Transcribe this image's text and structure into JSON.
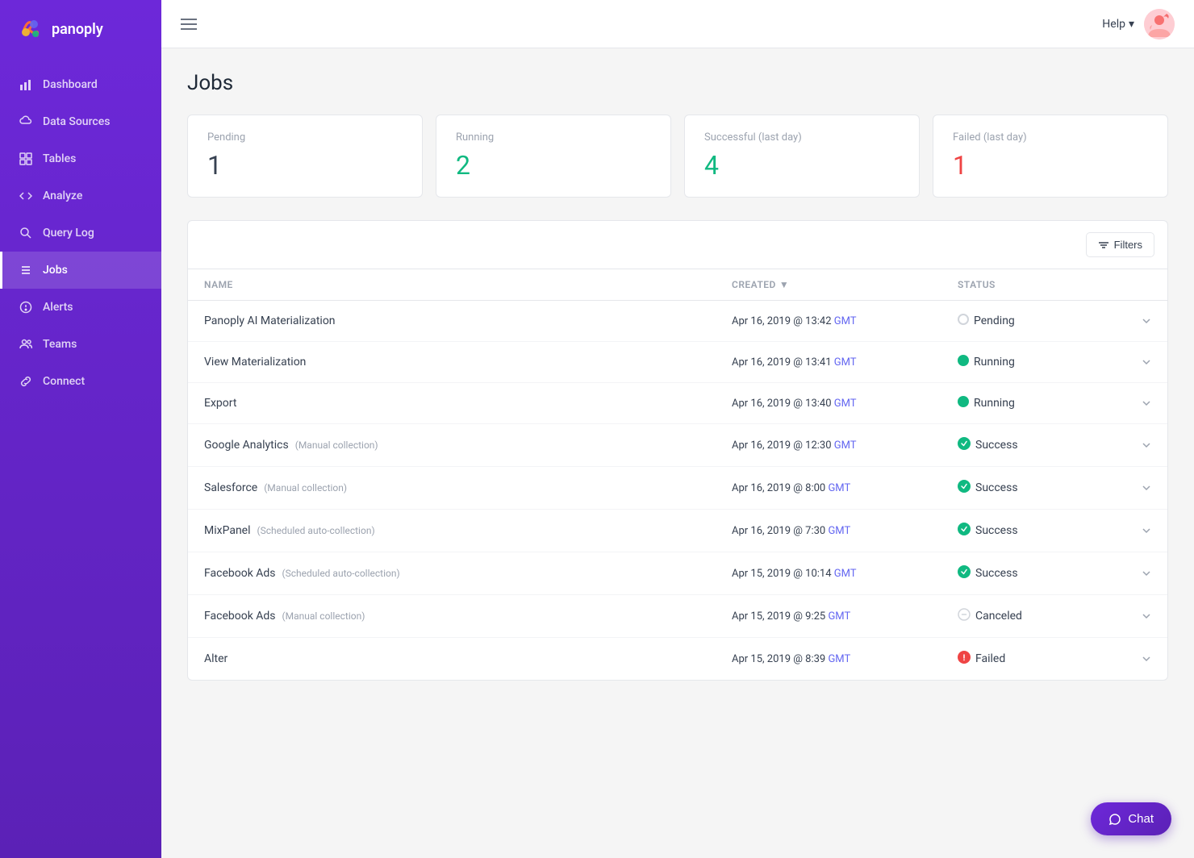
{
  "app": {
    "name": "panoply"
  },
  "topbar": {
    "help_label": "Help",
    "help_chevron": "▾"
  },
  "sidebar": {
    "items": [
      {
        "id": "dashboard",
        "label": "Dashboard",
        "icon": "bar-chart-icon",
        "active": false
      },
      {
        "id": "data-sources",
        "label": "Data Sources",
        "icon": "cloud-icon",
        "active": false
      },
      {
        "id": "tables",
        "label": "Tables",
        "icon": "grid-icon",
        "active": false
      },
      {
        "id": "analyze",
        "label": "Analyze",
        "icon": "code-icon",
        "active": false
      },
      {
        "id": "query-log",
        "label": "Query Log",
        "icon": "search-icon",
        "active": false
      },
      {
        "id": "jobs",
        "label": "Jobs",
        "icon": "list-icon",
        "active": true
      },
      {
        "id": "alerts",
        "label": "Alerts",
        "icon": "alert-icon",
        "active": false
      },
      {
        "id": "teams",
        "label": "Teams",
        "icon": "team-icon",
        "active": false
      },
      {
        "id": "connect",
        "label": "Connect",
        "icon": "link-icon",
        "active": false
      }
    ]
  },
  "page": {
    "title": "Jobs"
  },
  "stats": [
    {
      "label": "Pending",
      "value": "1",
      "type": "pending"
    },
    {
      "label": "Running",
      "value": "2",
      "type": "running"
    },
    {
      "label": "Successful (last day)",
      "value": "4",
      "type": "success"
    },
    {
      "label": "Failed (last day)",
      "value": "1",
      "type": "failed"
    }
  ],
  "filters_label": "Filters",
  "table": {
    "columns": [
      "Name",
      "Created",
      "Status"
    ],
    "rows": [
      {
        "name": "Panoply AI Materialization",
        "tag": "",
        "date": "Apr 16, 2019 @ 13:42",
        "gmt": "GMT",
        "status": "Pending",
        "status_type": "pending"
      },
      {
        "name": "View Materialization",
        "tag": "",
        "date": "Apr 16, 2019 @ 13:41",
        "gmt": "GMT",
        "status": "Running",
        "status_type": "running"
      },
      {
        "name": "Export",
        "tag": "",
        "date": "Apr 16, 2019 @ 13:40",
        "gmt": "GMT",
        "status": "Running",
        "status_type": "running"
      },
      {
        "name": "Google Analytics",
        "tag": "(Manual collection)",
        "date": "Apr 16, 2019 @ 12:30",
        "gmt": "GMT",
        "status": "Success",
        "status_type": "success"
      },
      {
        "name": "Salesforce",
        "tag": "(Manual collection)",
        "date": "Apr 16, 2019 @ 8:00",
        "gmt": "GMT",
        "status": "Success",
        "status_type": "success"
      },
      {
        "name": "MixPanel",
        "tag": "(Scheduled auto-collection)",
        "date": "Apr 16, 2019 @ 7:30",
        "gmt": "GMT",
        "status": "Success",
        "status_type": "success"
      },
      {
        "name": "Facebook Ads",
        "tag": "(Scheduled auto-collection)",
        "date": "Apr 15, 2019 @ 10:14",
        "gmt": "GMT",
        "status": "Success",
        "status_type": "success"
      },
      {
        "name": "Facebook Ads",
        "tag": "(Manual collection)",
        "date": "Apr 15, 2019 @ 9:25",
        "gmt": "GMT",
        "status": "Canceled",
        "status_type": "cancelled"
      },
      {
        "name": "Alter",
        "tag": "",
        "date": "Apr 15, 2019 @ 8:39",
        "gmt": "GMT",
        "status": "Failed",
        "status_type": "failed"
      }
    ]
  },
  "chat_label": "Chat"
}
